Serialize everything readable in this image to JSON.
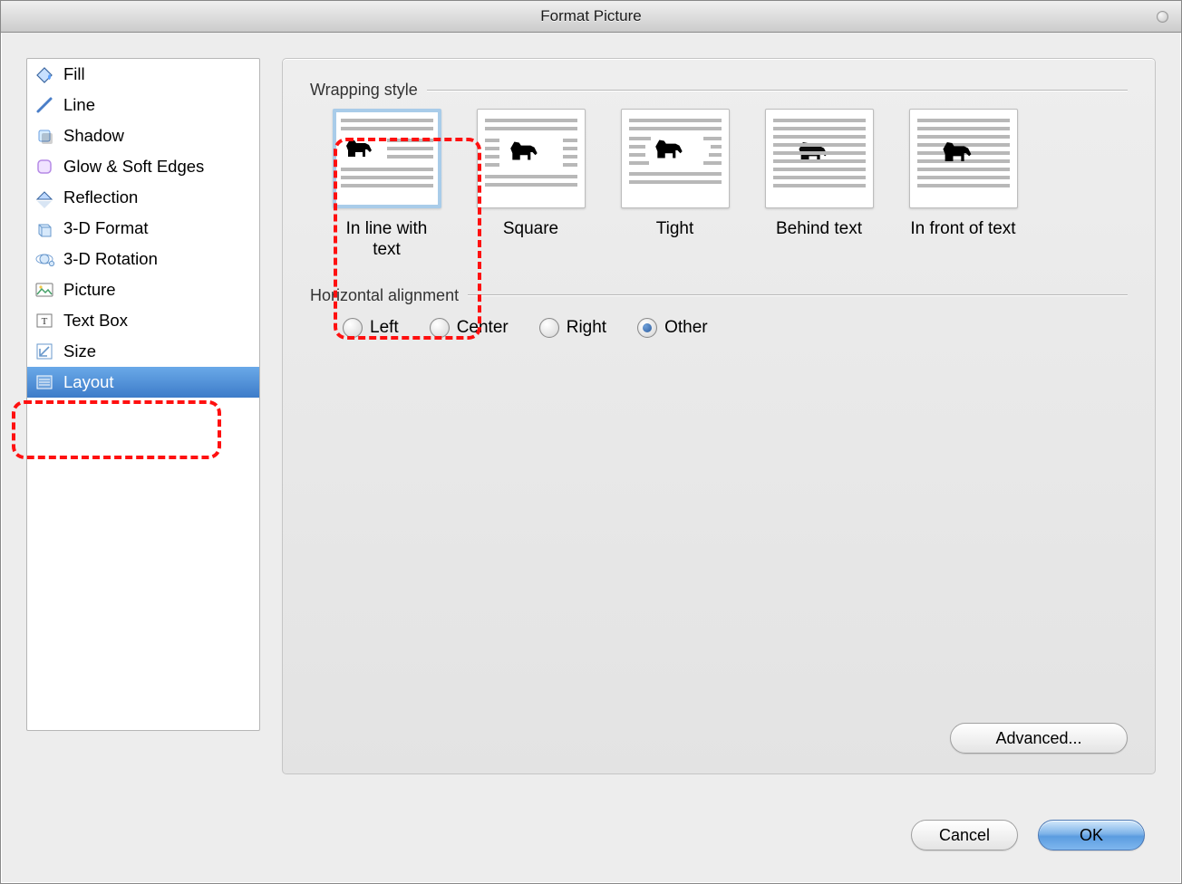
{
  "window": {
    "title": "Format Picture"
  },
  "sidebar": {
    "items": [
      {
        "label": "Fill",
        "selected": false
      },
      {
        "label": "Line",
        "selected": false
      },
      {
        "label": "Shadow",
        "selected": false
      },
      {
        "label": "Glow & Soft Edges",
        "selected": false
      },
      {
        "label": "Reflection",
        "selected": false
      },
      {
        "label": "3-D Format",
        "selected": false
      },
      {
        "label": "3-D Rotation",
        "selected": false
      },
      {
        "label": "Picture",
        "selected": false
      },
      {
        "label": "Text Box",
        "selected": false
      },
      {
        "label": "Size",
        "selected": false
      },
      {
        "label": "Layout",
        "selected": true
      }
    ]
  },
  "sections": {
    "wrapping_label": "Wrapping style",
    "alignment_label": "Horizontal alignment"
  },
  "wrap_options": [
    {
      "label": "In line with text",
      "selected": true
    },
    {
      "label": "Square",
      "selected": false
    },
    {
      "label": "Tight",
      "selected": false
    },
    {
      "label": "Behind text",
      "selected": false
    },
    {
      "label": "In front of text",
      "selected": false
    }
  ],
  "alignment_options": [
    {
      "label": "Left",
      "selected": false
    },
    {
      "label": "Center",
      "selected": false
    },
    {
      "label": "Right",
      "selected": false
    },
    {
      "label": "Other",
      "selected": true
    }
  ],
  "buttons": {
    "advanced": "Advanced...",
    "cancel": "Cancel",
    "ok": "OK"
  }
}
